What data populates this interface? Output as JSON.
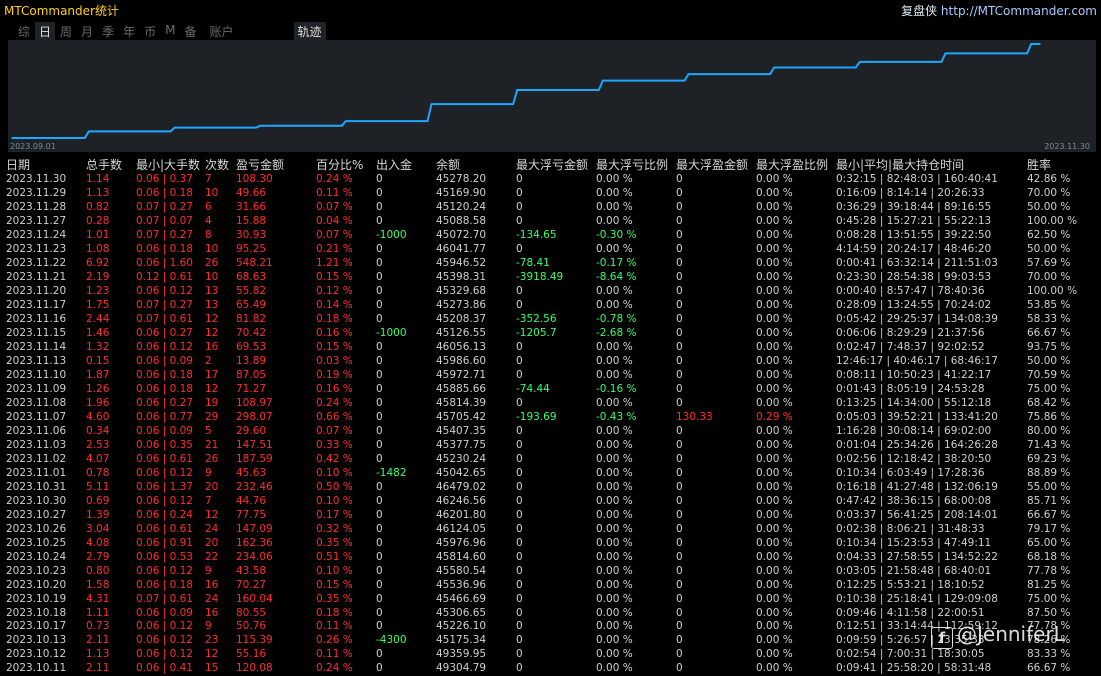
{
  "app": {
    "title": "MTCommander统计",
    "brand_name": "复盘侠",
    "brand_url": "http://MTCommander.com"
  },
  "tabs": [
    "综",
    "日",
    "周",
    "月",
    "季",
    "年",
    "币",
    "M",
    "备",
    "账户",
    "轨迹"
  ],
  "active_tab": "日",
  "chart": {
    "start_label": "2023.09.01",
    "end_label": "2023.11.30",
    "line_color": "#1ea7ff",
    "chart_data": {
      "type": "line",
      "title": "",
      "xlabel": "",
      "ylabel": "",
      "x": [
        "2023.09.01",
        "2023.09.15",
        "2023.10.01",
        "2023.10.10",
        "2023.10.13",
        "2023.10.20",
        "2023.10.31",
        "2023.11.07",
        "2023.11.10",
        "2023.11.15",
        "2023.11.21",
        "2023.11.24",
        "2023.11.30"
      ],
      "values": [
        0,
        70,
        110,
        130,
        180,
        360,
        510,
        610,
        680,
        750,
        810,
        900,
        1000
      ]
    }
  },
  "table": {
    "headers": [
      "日期",
      "总手数",
      "最小|大手数",
      "次数",
      "盈亏金额",
      "百分比%",
      "出入金",
      "余额",
      "最大浮亏金额",
      "最大浮亏比例",
      "最大浮盈金额",
      "最大浮盈比例",
      "最小|平均|最大持仓时间",
      "胜率"
    ],
    "rows": [
      [
        "2023.11.30",
        "1.14",
        "0.06 | 0.37",
        "7",
        "108.30",
        "0.24 %",
        "0",
        "45278.20",
        "0",
        "0.00 %",
        "0",
        "0.00 %",
        "0:32:15 | 82:48:03 | 160:40:41",
        "42.86 %"
      ],
      [
        "2023.11.29",
        "1.13",
        "0.06 | 0.18",
        "10",
        "49.66",
        "0.11 %",
        "0",
        "45169.90",
        "0",
        "0.00 %",
        "0",
        "0.00 %",
        "0:16:09 | 8:14:14 | 20:26:33",
        "70.00 %"
      ],
      [
        "2023.11.28",
        "0.82",
        "0.07 | 0.27",
        "6",
        "31.66",
        "0.07 %",
        "0",
        "45120.24",
        "0",
        "0.00 %",
        "0",
        "0.00 %",
        "0:36:29 | 39:18:44 | 89:16:55",
        "50.00 %"
      ],
      [
        "2023.11.27",
        "0.28",
        "0.07 | 0.07",
        "4",
        "15.88",
        "0.04 %",
        "0",
        "45088.58",
        "0",
        "0.00 %",
        "0",
        "0.00 %",
        "0:45:28 | 15:27:21 | 55:22:13",
        "100.00 %"
      ],
      [
        "2023.11.24",
        "1.01",
        "0.07 | 0.27",
        "8",
        "30.93",
        "0.07 %",
        "-1000",
        "45072.70",
        "-134.65",
        "-0.30 %",
        "0",
        "0.00 %",
        "0:08:28 | 13:51:55 | 39:22:50",
        "62.50 %"
      ],
      [
        "2023.11.23",
        "1.08",
        "0.06 | 0.18",
        "10",
        "95.25",
        "0.21 %",
        "0",
        "46041.77",
        "0",
        "0.00 %",
        "0",
        "0.00 %",
        "4:14:59 | 20:24:17 | 48:46:20",
        "50.00 %"
      ],
      [
        "2023.11.22",
        "6.92",
        "0.06 | 1.60",
        "26",
        "548.21",
        "1.21 %",
        "0",
        "45946.52",
        "-78.41",
        "-0.17 %",
        "0",
        "0.00 %",
        "0:00:41 | 63:32:14 | 211:51:03",
        "57.69 %"
      ],
      [
        "2023.11.21",
        "2.19",
        "0.12 | 0.61",
        "10",
        "68.63",
        "0.15 %",
        "0",
        "45398.31",
        "-3918.49",
        "-8.64 %",
        "0",
        "0.00 %",
        "0:23:30 | 28:54:38 | 99:03:53",
        "70.00 %"
      ],
      [
        "2023.11.20",
        "1.23",
        "0.06 | 0.12",
        "13",
        "55.82",
        "0.12 %",
        "0",
        "45329.68",
        "0",
        "0.00 %",
        "0",
        "0.00 %",
        "0:00:40 | 8:57:47 | 78:40:36",
        "100.00 %"
      ],
      [
        "2023.11.17",
        "1.75",
        "0.07 | 0.27",
        "13",
        "65.49",
        "0.14 %",
        "0",
        "45273.86",
        "0",
        "0.00 %",
        "0",
        "0.00 %",
        "0:28:09 | 13:24:55 | 70:24:02",
        "53.85 %"
      ],
      [
        "2023.11.16",
        "2.44",
        "0.07 | 0.61",
        "12",
        "81.82",
        "0.18 %",
        "0",
        "45208.37",
        "-352.56",
        "-0.78 %",
        "0",
        "0.00 %",
        "0:05:42 | 29:25:37 | 134:08:39",
        "58.33 %"
      ],
      [
        "2023.11.15",
        "1.46",
        "0.06 | 0.27",
        "12",
        "70.42",
        "0.16 %",
        "-1000",
        "45126.55",
        "-1205.7",
        "-2.68 %",
        "0",
        "0.00 %",
        "0:06:06 | 8:29:29 | 21:37:56",
        "66.67 %"
      ],
      [
        "2023.11.14",
        "1.32",
        "0.06 | 0.12",
        "16",
        "69.53",
        "0.15 %",
        "0",
        "46056.13",
        "0",
        "0.00 %",
        "0",
        "0.00 %",
        "0:02:47 | 7:48:37 | 92:02:52",
        "93.75 %"
      ],
      [
        "2023.11.13",
        "0.15",
        "0.06 | 0.09",
        "2",
        "13.89",
        "0.03 %",
        "0",
        "45986.60",
        "0",
        "0.00 %",
        "0",
        "0.00 %",
        "12:46:17 | 40:46:17 | 68:46:17",
        "50.00 %"
      ],
      [
        "2023.11.10",
        "1.87",
        "0.06 | 0.18",
        "17",
        "87.05",
        "0.19 %",
        "0",
        "45972.71",
        "0",
        "0.00 %",
        "0",
        "0.00 %",
        "0:08:11 | 10:50:23 | 41:22:17",
        "70.59 %"
      ],
      [
        "2023.11.09",
        "1.26",
        "0.06 | 0.18",
        "12",
        "71.27",
        "0.16 %",
        "0",
        "45885.66",
        "-74.44",
        "-0.16 %",
        "0",
        "0.00 %",
        "0:01:43 | 8:05:19 | 24:53:28",
        "75.00 %"
      ],
      [
        "2023.11.08",
        "1.96",
        "0.06 | 0.27",
        "19",
        "108.97",
        "0.24 %",
        "0",
        "45814.39",
        "0",
        "0.00 %",
        "0",
        "0.00 %",
        "0:13:25 | 14:34:00 | 55:12:18",
        "68.42 %"
      ],
      [
        "2023.11.07",
        "4.60",
        "0.06 | 0.77",
        "29",
        "298.07",
        "0.66 %",
        "0",
        "45705.42",
        "-193.69",
        "-0.43 %",
        "130.33",
        "0.29 %",
        "0:05:03 | 39:52:21 | 133:41:20",
        "75.86 %"
      ],
      [
        "2023.11.06",
        "0.34",
        "0.06 | 0.09",
        "5",
        "29.60",
        "0.07 %",
        "0",
        "45407.35",
        "0",
        "0.00 %",
        "0",
        "0.00 %",
        "1:16:28 | 30:08:14 | 69:02:00",
        "80.00 %"
      ],
      [
        "2023.11.03",
        "2.53",
        "0.06 | 0.35",
        "21",
        "147.51",
        "0.33 %",
        "0",
        "45377.75",
        "0",
        "0.00 %",
        "0",
        "0.00 %",
        "0:01:04 | 25:34:26 | 164:26:28",
        "71.43 %"
      ],
      [
        "2023.11.02",
        "4.07",
        "0.06 | 0.61",
        "26",
        "187.59",
        "0.42 %",
        "0",
        "45230.24",
        "0",
        "0.00 %",
        "0",
        "0.00 %",
        "0:02:56 | 12:18:42 | 38:20:50",
        "69.23 %"
      ],
      [
        "2023.11.01",
        "0.78",
        "0.06 | 0.12",
        "9",
        "45.63",
        "0.10 %",
        "-1482",
        "45042.65",
        "0",
        "0.00 %",
        "0",
        "0.00 %",
        "0:10:34 | 6:03:49 | 17:28:36",
        "88.89 %"
      ],
      [
        "2023.10.31",
        "5.11",
        "0.06 | 1.37",
        "20",
        "232.46",
        "0.50 %",
        "0",
        "46479.02",
        "0",
        "0.00 %",
        "0",
        "0.00 %",
        "0:16:18 | 41:27:48 | 132:06:19",
        "55.00 %"
      ],
      [
        "2023.10.30",
        "0.69",
        "0.06 | 0.12",
        "7",
        "44.76",
        "0.10 %",
        "0",
        "46246.56",
        "0",
        "0.00 %",
        "0",
        "0.00 %",
        "0:47:42 | 38:36:15 | 68:00:08",
        "85.71 %"
      ],
      [
        "2023.10.27",
        "1.39",
        "0.06 | 0.24",
        "12",
        "77.75",
        "0.17 %",
        "0",
        "46201.80",
        "0",
        "0.00 %",
        "0",
        "0.00 %",
        "0:03:37 | 56:41:25 | 208:14:01",
        "66.67 %"
      ],
      [
        "2023.10.26",
        "3.04",
        "0.06 | 0.61",
        "24",
        "147.09",
        "0.32 %",
        "0",
        "46124.05",
        "0",
        "0.00 %",
        "0",
        "0.00 %",
        "0:02:38 | 8:06:21 | 31:48:33",
        "79.17 %"
      ],
      [
        "2023.10.25",
        "4.08",
        "0.06 | 0.91",
        "20",
        "162.36",
        "0.35 %",
        "0",
        "45976.96",
        "0",
        "0.00 %",
        "0",
        "0.00 %",
        "0:10:34 | 15:23:53 | 47:49:11",
        "65.00 %"
      ],
      [
        "2023.10.24",
        "2.79",
        "0.06 | 0.53",
        "22",
        "234.06",
        "0.51 %",
        "0",
        "45814.60",
        "0",
        "0.00 %",
        "0",
        "0.00 %",
        "0:04:33 | 27:58:55 | 134:52:22",
        "68.18 %"
      ],
      [
        "2023.10.23",
        "0.80",
        "0.06 | 0.12",
        "9",
        "43.58",
        "0.10 %",
        "0",
        "45580.54",
        "0",
        "0.00 %",
        "0",
        "0.00 %",
        "0:03:05 | 21:58:48 | 68:40:01",
        "77.78 %"
      ],
      [
        "2023.10.20",
        "1.58",
        "0.06 | 0.18",
        "16",
        "70.27",
        "0.15 %",
        "0",
        "45536.96",
        "0",
        "0.00 %",
        "0",
        "0.00 %",
        "0:12:25 | 5:53:21 | 18:10:52",
        "81.25 %"
      ],
      [
        "2023.10.19",
        "4.31",
        "0.07 | 0.61",
        "24",
        "160.04",
        "0.35 %",
        "0",
        "45466.69",
        "0",
        "0.00 %",
        "0",
        "0.00 %",
        "0:10:38 | 25:18:41 | 129:09:08",
        "75.00 %"
      ],
      [
        "2023.10.18",
        "1.11",
        "0.06 | 0.09",
        "16",
        "80.55",
        "0.18 %",
        "0",
        "45306.65",
        "0",
        "0.00 %",
        "0",
        "0.00 %",
        "0:09:46 | 4:11:58 | 22:00:51",
        "87.50 %"
      ],
      [
        "2023.10.17",
        "0.73",
        "0.06 | 0.12",
        "9",
        "50.76",
        "0.11 %",
        "0",
        "45226.10",
        "0",
        "0.00 %",
        "0",
        "0.00 %",
        "0:12:51 | 33:14:44 | 112:59:12",
        "77.78 %"
      ],
      [
        "2023.10.13",
        "2.11",
        "0.06 | 0.12",
        "23",
        "115.39",
        "0.26 %",
        "-4300",
        "45175.34",
        "0",
        "0.00 %",
        "0",
        "0.00 %",
        "0:09:59 | 5:26:57 | 23:35:33",
        "78.26 %"
      ],
      [
        "2023.10.12",
        "1.13",
        "0.06 | 0.12",
        "12",
        "55.16",
        "0.11 %",
        "0",
        "49359.95",
        "0",
        "0.00 %",
        "0",
        "0.00 %",
        "0:02:54 | 7:00:31 | 18:30:05",
        "83.33 %"
      ],
      [
        "2023.10.11",
        "2.11",
        "0.06 | 0.41",
        "15",
        "120.08",
        "0.24 %",
        "0",
        "49304.79",
        "0",
        "0.00 %",
        "0",
        "0.00 %",
        "0:09:41 | 25:58:20 | 58:31:48",
        "66.67 %"
      ]
    ]
  },
  "watermark": {
    "icon_letter": "f",
    "text": "@JenniferL"
  }
}
